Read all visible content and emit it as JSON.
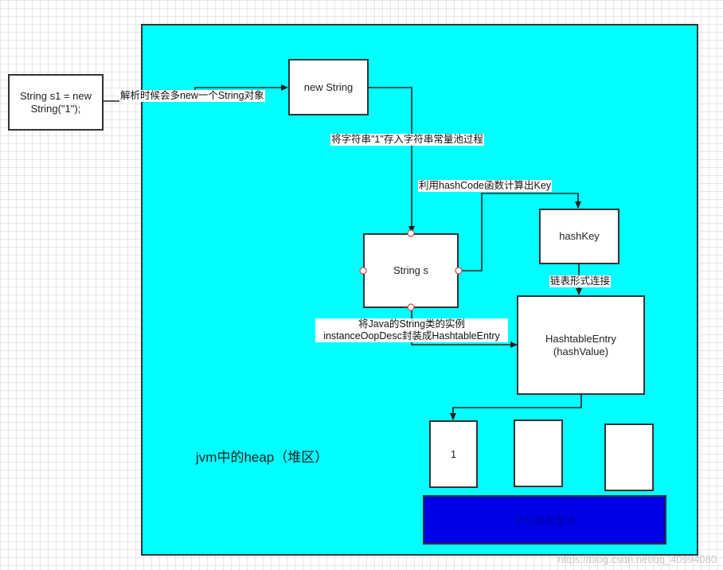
{
  "code_box": {
    "text": "String s1 = new String(\"1\");"
  },
  "new_string_box": {
    "text": "new String"
  },
  "string_s_box": {
    "text": "String s"
  },
  "hashkey_box": {
    "text": "hashKey"
  },
  "hashtable_entry_box": {
    "line1": "HashtableEntry",
    "line2": "(hashValue)"
  },
  "pool_item_box": {
    "text": "1"
  },
  "pool": {
    "label": "字符串常量池",
    "color": "#0000e6"
  },
  "heap": {
    "title": "jvm中的heap（堆区）",
    "color": "#00ffff"
  },
  "labels": {
    "parse": "解析时候会多new一个String对象",
    "store": "将字符串\"1\"存入字符串常量池过程",
    "hashcode": "利用hashCode函数计算出Key",
    "linked": "链表形式连接",
    "wrap_line1": "将Java的String类的实例",
    "wrap_line2": "instanceOopDesc封装成HashtableEntry"
  },
  "watermark": "https://blog.csdn.net/qq_40994080"
}
